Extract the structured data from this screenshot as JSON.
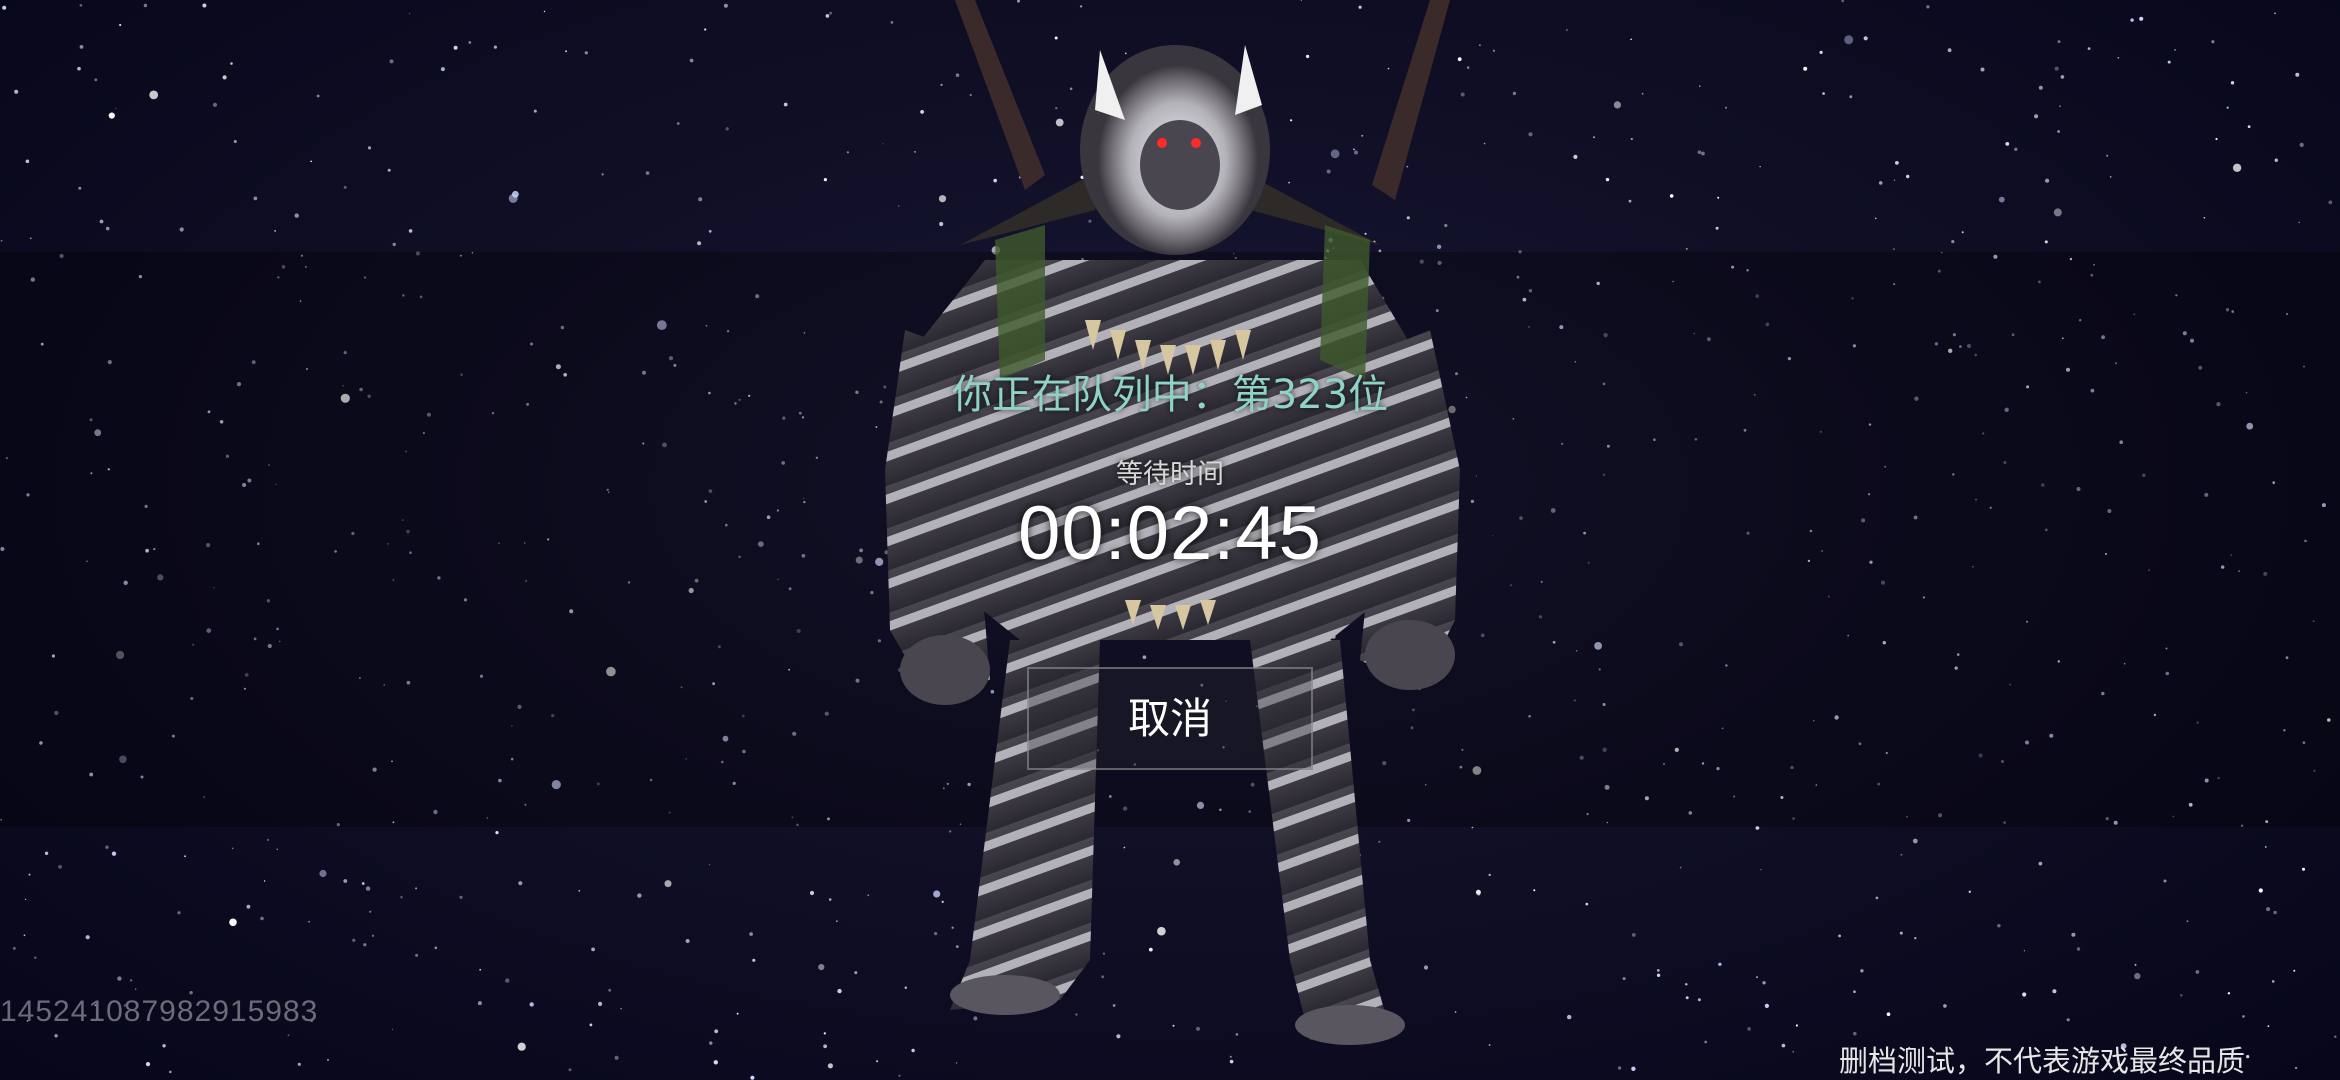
{
  "queue": {
    "prefix": "你正在队列中：",
    "position": "第323位"
  },
  "wait": {
    "label": "等待时间",
    "timer": "00:02:45"
  },
  "cancel_button": {
    "label": "取消"
  },
  "footer": {
    "player_id": "14524108798291​5983",
    "disclaimer": "删档测试，不代表游戏最终品质"
  },
  "colors": {
    "queue_text": "#8fd3c7",
    "background": "#0b0a1c",
    "button_border": "#a0a0a0"
  },
  "icons": {
    "character": "werewolf-character-model"
  }
}
